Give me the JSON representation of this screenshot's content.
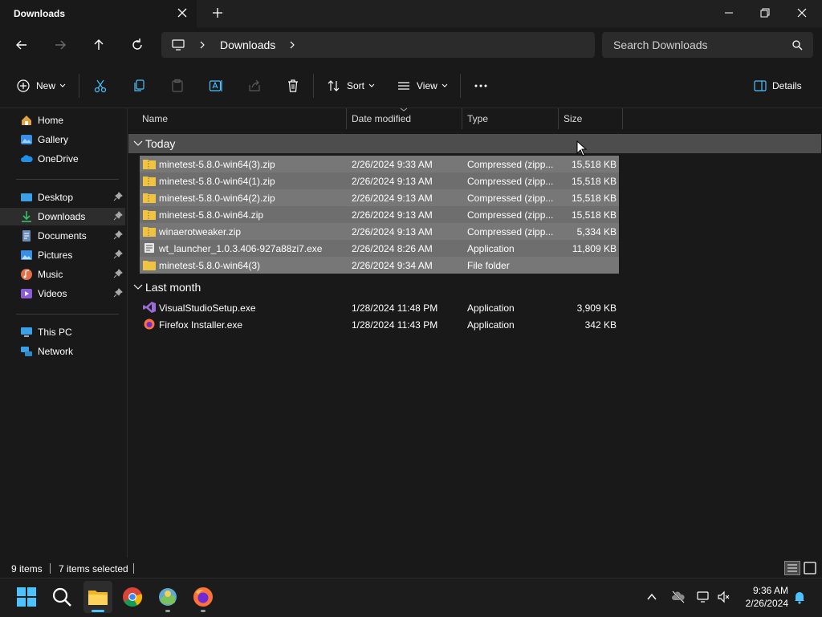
{
  "window": {
    "tab_title": "Downloads",
    "breadcrumb": "Downloads",
    "search_placeholder": "Search Downloads"
  },
  "toolbar": {
    "new_label": "New",
    "sort_label": "Sort",
    "view_label": "View",
    "details_label": "Details"
  },
  "sidebar": {
    "items": [
      {
        "label": "Home",
        "icon": "home-icon"
      },
      {
        "label": "Gallery",
        "icon": "gallery-icon"
      },
      {
        "label": "OneDrive",
        "icon": "cloud-icon"
      },
      {
        "label": "Desktop",
        "icon": "desktop-icon"
      },
      {
        "label": "Downloads",
        "icon": "download-icon"
      },
      {
        "label": "Documents",
        "icon": "document-icon"
      },
      {
        "label": "Pictures",
        "icon": "pictures-icon"
      },
      {
        "label": "Music",
        "icon": "music-icon"
      },
      {
        "label": "Videos",
        "icon": "videos-icon"
      },
      {
        "label": "This PC",
        "icon": "computer-icon"
      },
      {
        "label": "Network",
        "icon": "network-icon"
      }
    ]
  },
  "columns": {
    "name": "Name",
    "date": "Date modified",
    "type": "Type",
    "size": "Size"
  },
  "groups": {
    "today": "Today",
    "last_month": "Last month"
  },
  "files_today": [
    {
      "name": "minetest-5.8.0-win64(3).zip",
      "date": "2/26/2024 9:33 AM",
      "type": "Compressed (zipp...",
      "size": "15,518 KB",
      "icon": "zip-folder-icon"
    },
    {
      "name": "minetest-5.8.0-win64(1).zip",
      "date": "2/26/2024 9:13 AM",
      "type": "Compressed (zipp...",
      "size": "15,518 KB",
      "icon": "zip-folder-icon"
    },
    {
      "name": "minetest-5.8.0-win64(2).zip",
      "date": "2/26/2024 9:13 AM",
      "type": "Compressed (zipp...",
      "size": "15,518 KB",
      "icon": "zip-folder-icon"
    },
    {
      "name": "minetest-5.8.0-win64.zip",
      "date": "2/26/2024 9:13 AM",
      "type": "Compressed (zipp...",
      "size": "15,518 KB",
      "icon": "zip-folder-icon"
    },
    {
      "name": "winaerotweaker.zip",
      "date": "2/26/2024 9:13 AM",
      "type": "Compressed (zipp...",
      "size": "5,334 KB",
      "icon": "zip-folder-icon"
    },
    {
      "name": "wt_launcher_1.0.3.406-927a88zi7.exe",
      "date": "2/26/2024 8:26 AM",
      "type": "Application",
      "size": "11,809 KB",
      "icon": "exe-icon"
    },
    {
      "name": "minetest-5.8.0-win64(3)",
      "date": "2/26/2024 9:34 AM",
      "type": "File folder",
      "size": "",
      "icon": "folder-icon"
    }
  ],
  "files_last_month": [
    {
      "name": "VisualStudioSetup.exe",
      "date": "1/28/2024 11:48 PM",
      "type": "Application",
      "size": "3,909 KB",
      "icon": "visual-studio-icon"
    },
    {
      "name": "Firefox Installer.exe",
      "date": "1/28/2024 11:43 PM",
      "type": "Application",
      "size": "342 KB",
      "icon": "firefox-icon"
    }
  ],
  "status": {
    "items": "9 items",
    "selected": "7 items selected"
  },
  "taskbar": {
    "time": "9:36 AM",
    "date": "2/26/2024"
  },
  "colors": {
    "selection": "#777777",
    "folder": "#f0c343",
    "accent": "#4cc2ff"
  }
}
